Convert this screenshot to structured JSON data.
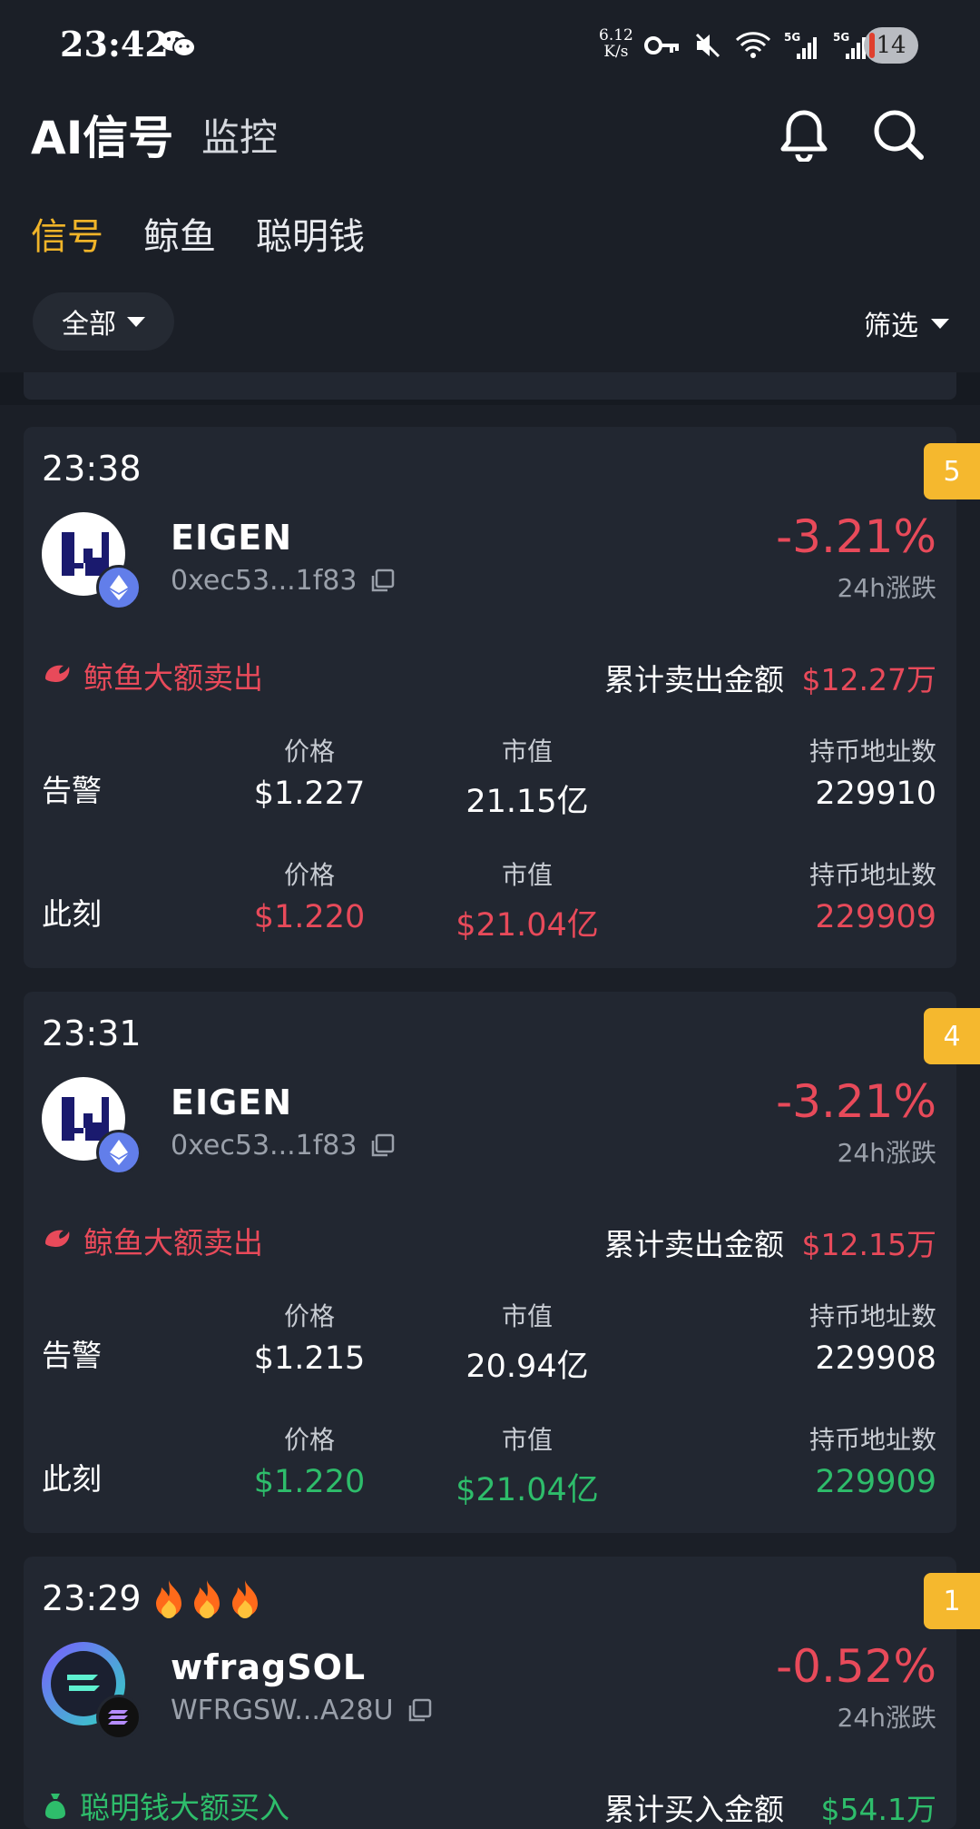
{
  "status_bar": {
    "time": "23:42",
    "net_speed_value": "6.12",
    "net_speed_unit": "K/s",
    "battery": "14"
  },
  "header": {
    "title": "AI信号",
    "tab_monitor": "监控"
  },
  "subtabs": [
    "信号",
    "鲸鱼",
    "聪明钱"
  ],
  "filters": {
    "all_label": "全部",
    "filter_label": "筛选"
  },
  "colors": {
    "accent": "#f0b429",
    "negative": "#e84a5a",
    "positive": "#2ebd6b",
    "badge": "#f5b82e"
  },
  "cards": [
    {
      "time": "23:38",
      "badge": "5",
      "name": "EIGEN",
      "address": "0xec53...1f83",
      "change": "-3.21%",
      "change_label": "24h涨跌",
      "event": "鲸鱼大额卖出",
      "cum_label": "累计卖出金额",
      "cum_value": "$12.27万",
      "alert_label": "告警",
      "now_label": "此刻",
      "col_price": "价格",
      "col_mcap": "市值",
      "col_holders": "持币地址数",
      "alert_price": "$1.227",
      "alert_mcap": "21.15亿",
      "alert_holders": "229910",
      "now_price": "$1.220",
      "now_mcap": "$21.04亿",
      "now_holders": "229909"
    },
    {
      "time": "23:31",
      "badge": "4",
      "name": "EIGEN",
      "address": "0xec53...1f83",
      "change": "-3.21%",
      "change_label": "24h涨跌",
      "event": "鲸鱼大额卖出",
      "cum_label": "累计卖出金额",
      "cum_value": "$12.15万",
      "alert_label": "告警",
      "now_label": "此刻",
      "col_price": "价格",
      "col_mcap": "市值",
      "col_holders": "持币地址数",
      "alert_price": "$1.215",
      "alert_mcap": "20.94亿",
      "alert_holders": "229908",
      "now_price": "$1.220",
      "now_mcap": "$21.04亿",
      "now_holders": "229909"
    },
    {
      "time": "23:29",
      "badge": "1",
      "name": "wfragSOL",
      "address": "WFRGSW...A28U",
      "change": "-0.52%",
      "change_label": "24h涨跌",
      "event": "聪明钱大额买入",
      "cum_label": "累计买入金额",
      "cum_value": "$54.1万"
    }
  ]
}
